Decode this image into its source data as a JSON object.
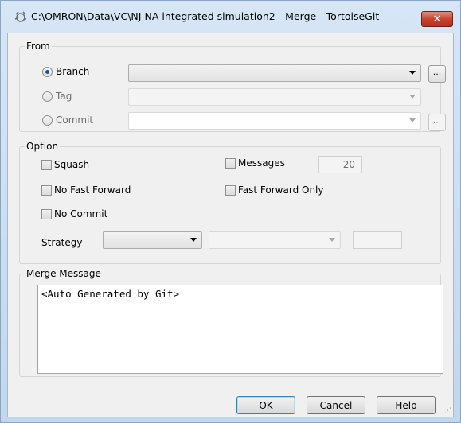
{
  "window": {
    "title": "C:\\OMRON\\Data\\VC\\NJ-NA integrated simulation2 - Merge - TortoiseGit",
    "close_symbol": "✕",
    "icon": "tortoisegit-icon"
  },
  "from": {
    "label": "From",
    "branch_label": "Branch",
    "tag_label": "Tag",
    "commit_label": "Commit",
    "selected": "Branch",
    "branch_value": "",
    "tag_value": "",
    "commit_value": "",
    "browse_label": "..."
  },
  "option": {
    "label": "Option",
    "squash_label": "Squash",
    "no_fast_forward_label": "No Fast Forward",
    "no_commit_label": "No Commit",
    "messages_label": "Messages",
    "messages_value": "20",
    "fast_forward_only_label": "Fast Forward Only",
    "strategy_label": "Strategy",
    "strategy_value": "",
    "strategy_option_value": ""
  },
  "merge_message": {
    "label": "Merge Message",
    "value": "<Auto Generated by Git>"
  },
  "buttons": {
    "ok": "OK",
    "cancel": "Cancel",
    "help": "Help"
  }
}
